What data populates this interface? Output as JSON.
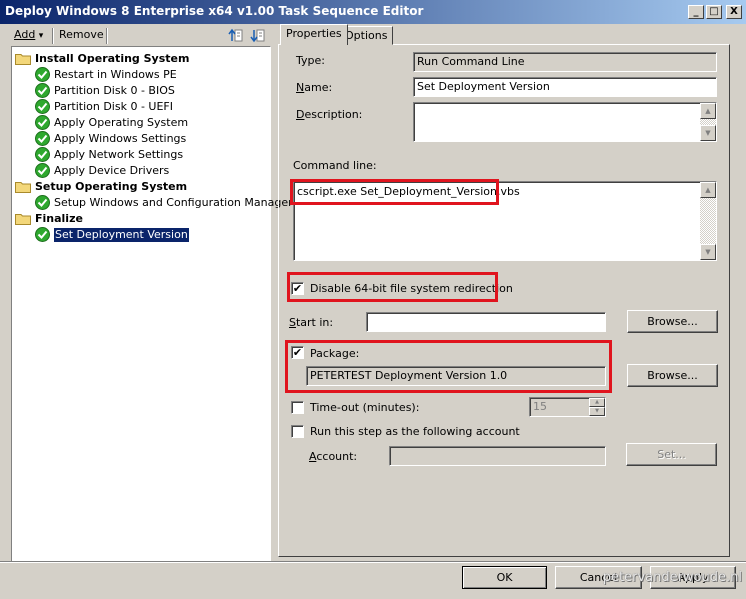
{
  "window": {
    "title": "Deploy Windows 8 Enterprise x64 v1.00 Task Sequence Editor",
    "controls": {
      "minimize": "_",
      "maximize": "□",
      "close": "X"
    }
  },
  "toolbar": {
    "add_label": "Add",
    "add_arrow": "▾",
    "remove_label": "Remove"
  },
  "tree": {
    "groups": [
      {
        "label": "Install Operating System",
        "items": [
          "Restart in Windows PE",
          "Partition Disk 0 - BIOS",
          "Partition Disk 0 - UEFI",
          "Apply Operating System",
          "Apply Windows Settings",
          "Apply Network Settings",
          "Apply Device Drivers"
        ]
      },
      {
        "label": "Setup Operating System",
        "items": [
          "Setup Windows and Configuration Manager"
        ]
      },
      {
        "label": "Finalize",
        "items": [
          "Set Deployment Version"
        ]
      }
    ],
    "selected": "Set Deployment Version"
  },
  "tabs": {
    "properties": "Properties",
    "options": "Options"
  },
  "properties": {
    "type_label": "Type:",
    "type_value": "Run Command Line",
    "name_label": "Name:",
    "name_value": "Set Deployment Version",
    "description_label": "Description:",
    "description_value": "",
    "command_line_label": "Command line:",
    "command_line_value": "cscript.exe Set_Deployment_Version.vbs",
    "disable_redirection_label": "Disable 64-bit file system redirection",
    "disable_redirection_checked": true,
    "start_in_label": "Start in:",
    "start_in_value": "",
    "browse_label": "Browse...",
    "package_label": "Package:",
    "package_checked": true,
    "package_value": "PETERTEST Deployment Version 1.0",
    "timeout_label": "Time-out (minutes):",
    "timeout_checked": false,
    "timeout_value": "15",
    "run_as_label": "Run this step as the following account",
    "run_as_checked": false,
    "account_label": "Account:",
    "account_value": "",
    "set_label": "Set..."
  },
  "buttons": {
    "ok": "OK",
    "cancel": "Cancel",
    "apply": "Apply"
  },
  "watermark": "petervanderwoude.nl",
  "colors": {
    "highlight": "#e0141e",
    "selection": "#0a246a",
    "check_green": "#2ea82e"
  },
  "icons": {
    "folder": "folder-icon",
    "check": "check-icon",
    "up": "scroll-up-icon",
    "down": "scroll-down-icon"
  }
}
